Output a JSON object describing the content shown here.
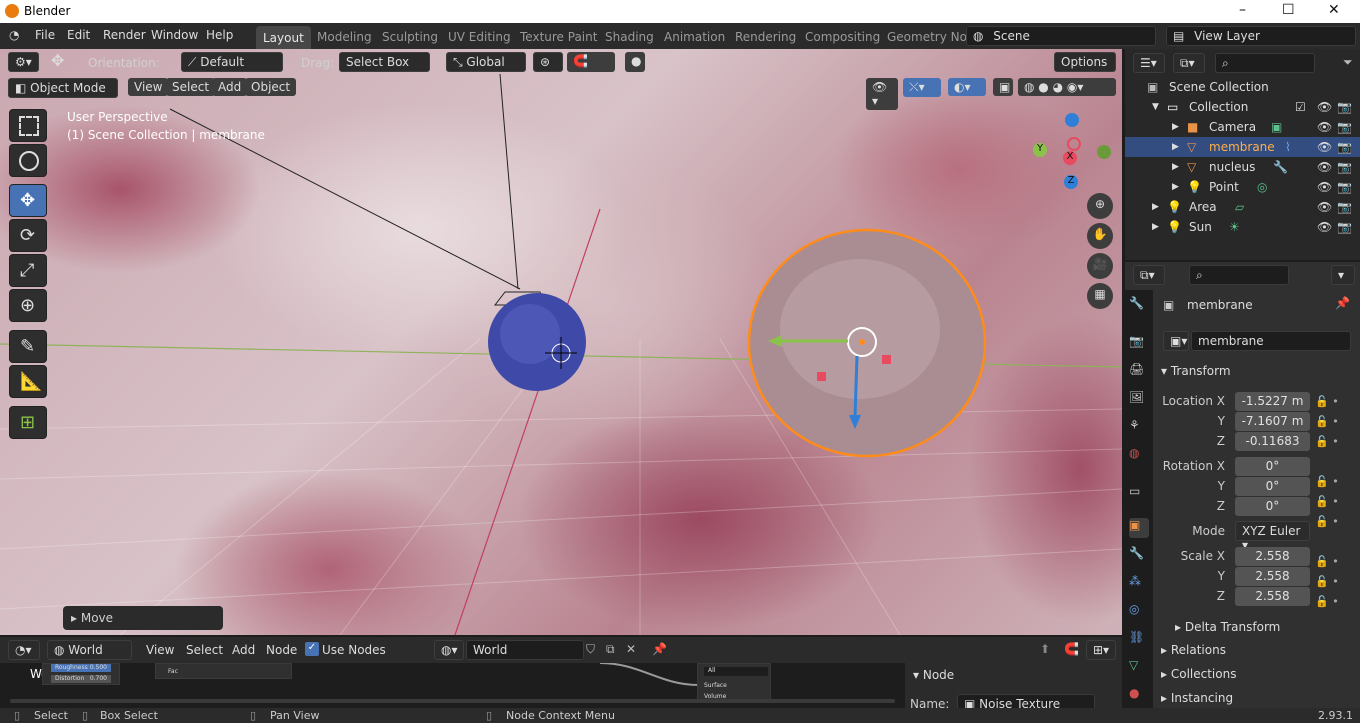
{
  "window": {
    "title": "Blender",
    "min": "–",
    "max": "☐",
    "close": "✕"
  },
  "menu": [
    "File",
    "Edit",
    "Render",
    "Window",
    "Help"
  ],
  "workspaces": [
    "Layout",
    "Modeling",
    "Sculpting",
    "UV Editing",
    "Texture Paint",
    "Shading",
    "Animation",
    "Rendering",
    "Compositing",
    "Geometry No"
  ],
  "scene": "Scene",
  "view_layer": "View Layer",
  "header": {
    "orientation_label": "Orientation:",
    "orientation": "Default",
    "drag_label": "Drag:",
    "drag": "Select Box",
    "transform": "Global",
    "options": "Options"
  },
  "viewport": {
    "mode": "Object Mode",
    "view": "View",
    "select": "Select",
    "add": "Add",
    "object": "Object",
    "perspective": "User Perspective",
    "context": "(1) Scene Collection | membrane",
    "last_op": "Move"
  },
  "gizmo": {
    "x": "X",
    "y": "Y",
    "z": "Z"
  },
  "outliner": {
    "root": "Scene Collection",
    "items": [
      "Collection",
      "Camera",
      "membrane",
      "nucleus",
      "Point",
      "Area",
      "Sun"
    ]
  },
  "props": {
    "object_name": "membrane",
    "data_name": "membrane",
    "transform": "Transform",
    "loc_label": "Location X",
    "loc": [
      "-1.5227 m",
      "-7.1607 m",
      "-0.11683"
    ],
    "rot_label": "Rotation X",
    "rot": [
      "0°",
      "0°",
      "0°"
    ],
    "mode_label": "Mode",
    "mode": "XYZ Euler",
    "scale_label": "Scale X",
    "scale": [
      "2.558",
      "2.558",
      "2.558"
    ],
    "axis_y": "Y",
    "axis_z": "Z",
    "delta": "Delta Transform",
    "relations": "Relations",
    "collections": "Collections",
    "instancing": "Instancing"
  },
  "node_editor": {
    "world_type": "World",
    "view": "View",
    "select": "Select",
    "add": "Add",
    "node": "Node",
    "use_nodes": "Use Nodes",
    "world_name": "World",
    "canvas_label": "World",
    "roughness": "Roughness",
    "roughness_val": "0.500",
    "distortion": "Distortion",
    "distortion_val": "0.700",
    "fac": "Fac",
    "all": "All",
    "surface": "Surface",
    "volume": "Volume",
    "panel_title": "Node",
    "name_label": "Name:",
    "name_value": "Noise Texture"
  },
  "status": {
    "select": "Select",
    "box_select": "Box Select",
    "pan_view": "Pan View",
    "node_context": "Node Context Menu",
    "version": "2.93.1"
  },
  "colors": {
    "accent": "#4772b3",
    "selection": "#ff8c1a",
    "x_axis": "#e84a5f",
    "y_axis": "#8bc34a",
    "z_axis": "#2f7fd8"
  }
}
